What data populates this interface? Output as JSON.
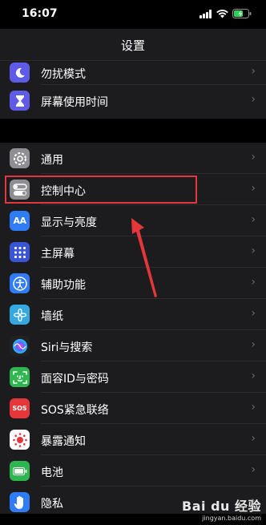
{
  "status_bar": {
    "time": "16:07"
  },
  "nav": {
    "title": "设置"
  },
  "group1": [
    {
      "label": "勿扰模式",
      "icon": "moon-icon",
      "color": "#5e5ce6"
    },
    {
      "label": "屏幕使用时间",
      "icon": "hourglass-icon",
      "color": "#5e5ce6"
    }
  ],
  "group2": [
    {
      "label": "通用",
      "icon": "gear-icon",
      "color": "#8e8e93"
    },
    {
      "label": "控制中心",
      "icon": "toggles-icon",
      "color": "#8e8e93"
    },
    {
      "label": "显示与亮度",
      "icon": "text-size-icon",
      "color": "#2f7cf6"
    },
    {
      "label": "主屏幕",
      "icon": "app-grid-icon",
      "color": "#3a54d6"
    },
    {
      "label": "辅助功能",
      "icon": "accessibility-icon",
      "color": "#2f7cf6"
    },
    {
      "label": "墙纸",
      "icon": "flower-icon",
      "color": "#36a8e0"
    },
    {
      "label": "Siri与搜索",
      "icon": "siri-icon",
      "color": "#222"
    },
    {
      "label": "面容ID与密码",
      "icon": "face-id-icon",
      "color": "#30b650"
    },
    {
      "label": "SOS紧急联络",
      "icon": "sos-icon",
      "color": "#e5373a"
    },
    {
      "label": "暴露通知",
      "icon": "exposure-icon",
      "color": "#fff"
    },
    {
      "label": "电池",
      "icon": "battery-icon",
      "color": "#30b650"
    },
    {
      "label": "隐私",
      "icon": "hand-icon",
      "color": "#2f7cf6"
    }
  ],
  "icon_text": {
    "text_size": "AA",
    "sos": "SOS"
  },
  "watermark": {
    "brand": "Bai du 经验",
    "url": "jingyan.baidu.com"
  }
}
